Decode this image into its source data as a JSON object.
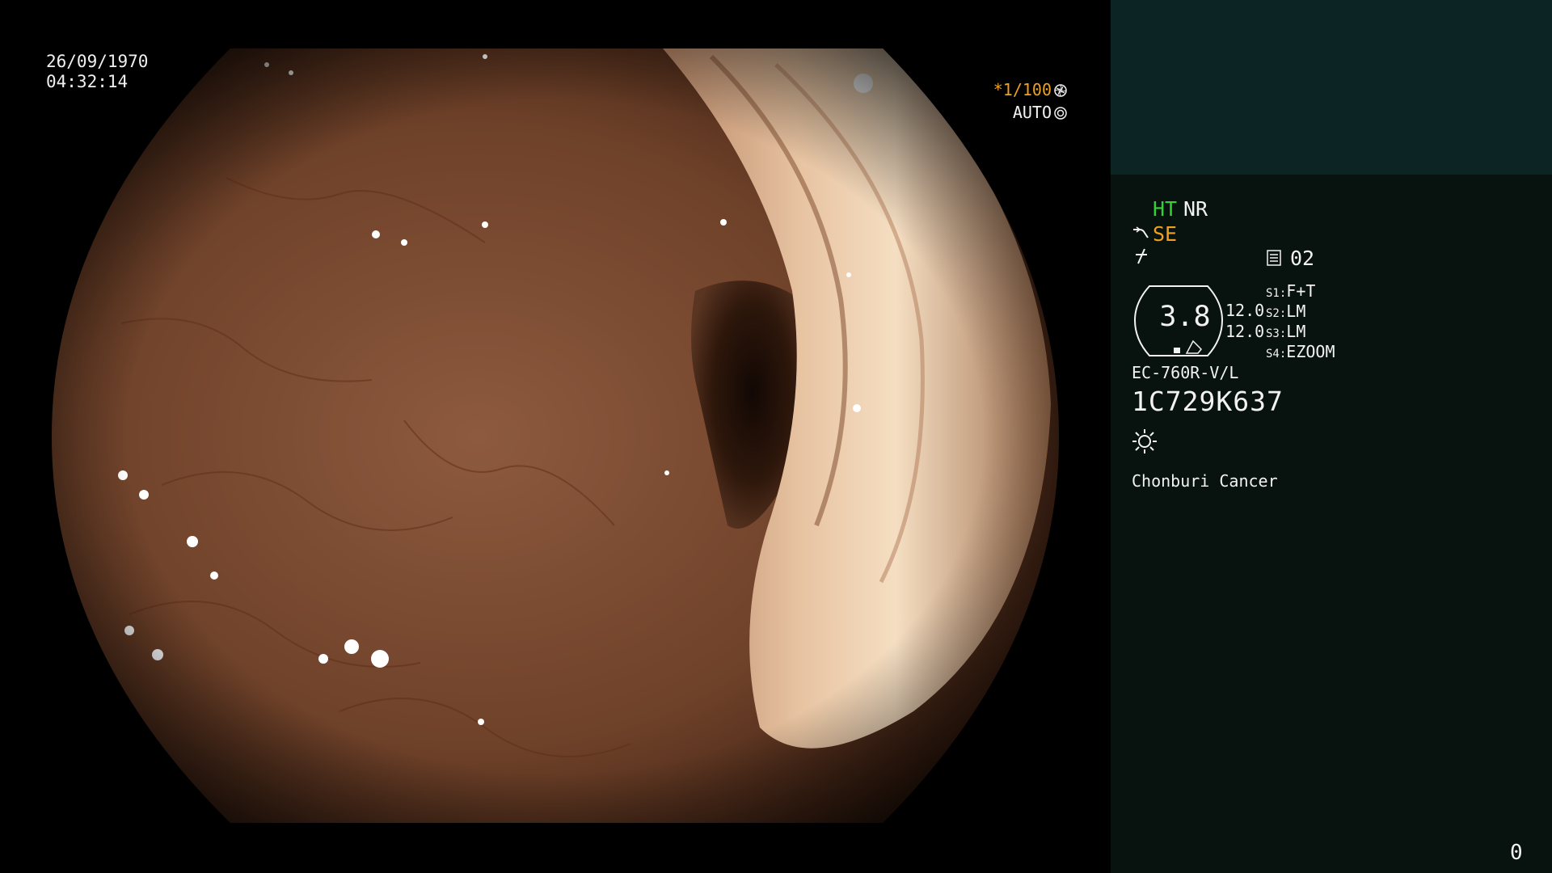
{
  "osd": {
    "date": "26/09/1970",
    "time": "04:32:14",
    "shutter_value": "*1/100",
    "exposure_mode": "AUTO"
  },
  "panel": {
    "mode_ht": "HT",
    "mode_nr": "NR",
    "mode_se": "SE",
    "memory_value": "02",
    "zoom_value": "3.8",
    "value_1": "12.0",
    "value_2": "12.0",
    "switches": [
      {
        "key": "S1:",
        "value": "F+T"
      },
      {
        "key": "S2:",
        "value": "LM"
      },
      {
        "key": "S3:",
        "value": "LM"
      },
      {
        "key": "S4:",
        "value": "EZOOM"
      }
    ],
    "scope_model": "EC-760R-V/L",
    "scope_serial": "1C729K637",
    "hospital": "Chonburi Cancer",
    "counter": "0"
  },
  "icons": {
    "shutter": "aperture-icon",
    "exposure": "exposure-ring-icon",
    "se": "scope-bend-icon",
    "freeze": "freeze-icon",
    "memory": "memory-card-icon",
    "light": "light-sun-icon"
  },
  "colors": {
    "ht": "#35d235",
    "se": "#f0a020",
    "shutter": "#f0a020",
    "panel_top": "#0d2424",
    "panel_bg": "#08130f"
  }
}
